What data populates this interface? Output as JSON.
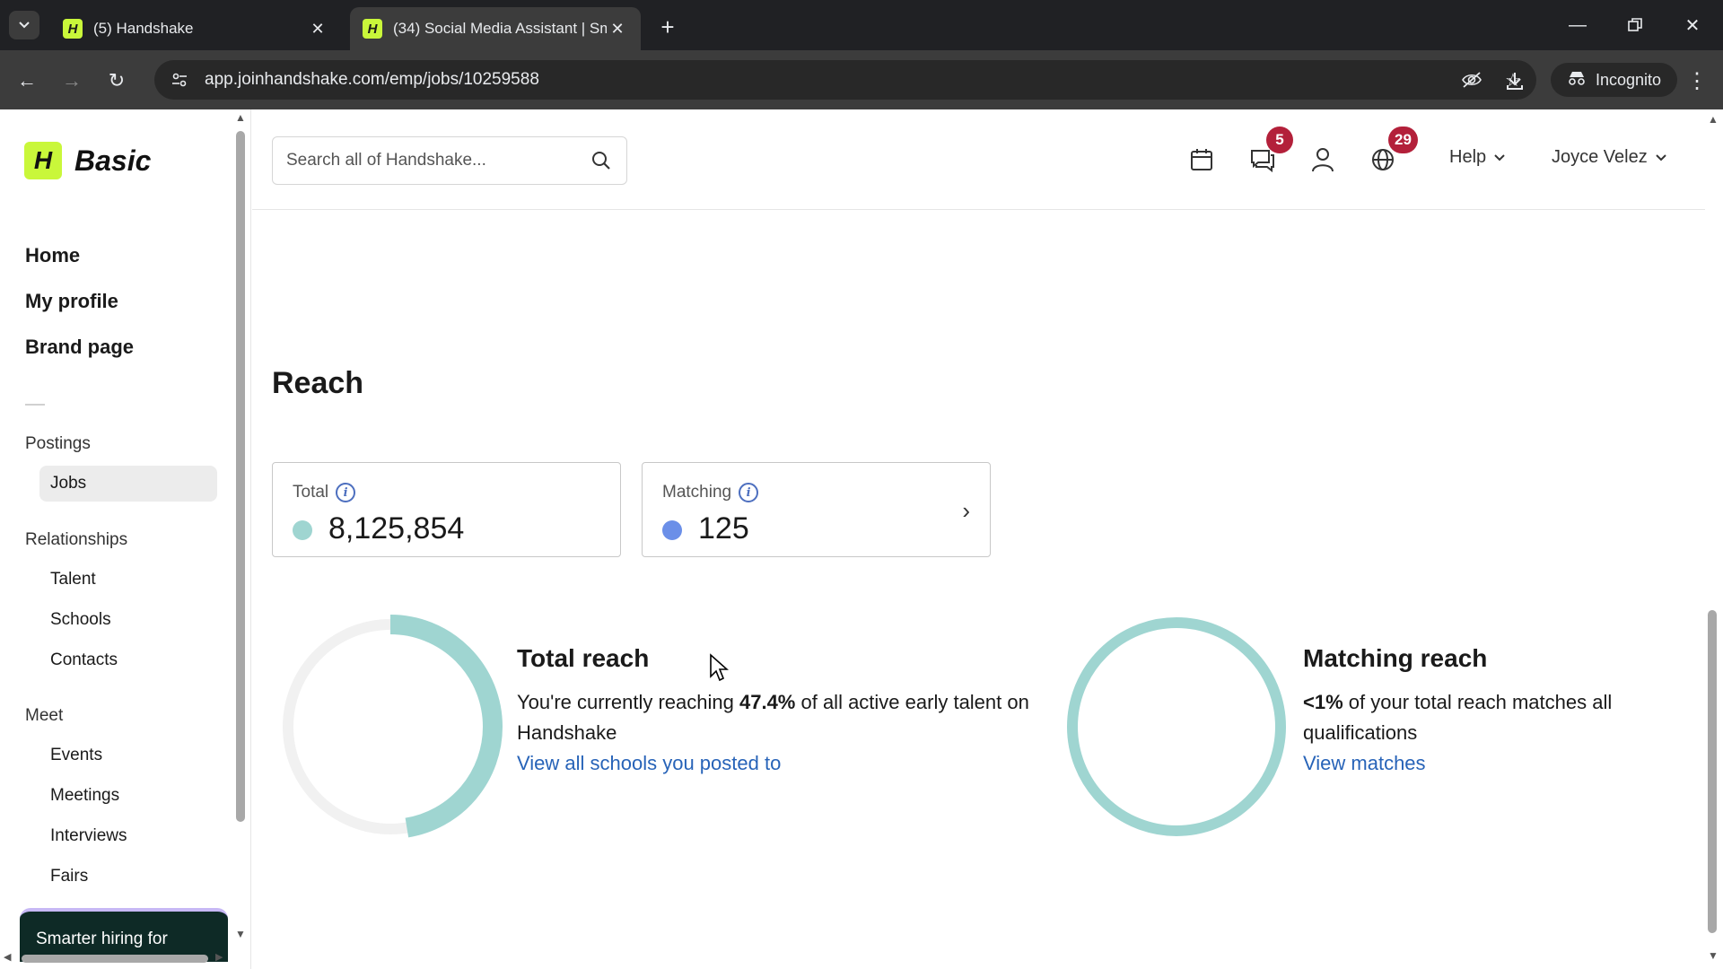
{
  "browser": {
    "tabs": [
      {
        "title": "(5) Handshake",
        "favicon": "H"
      },
      {
        "title": "(34) Social Media Assistant | Sm",
        "favicon": "H"
      }
    ],
    "url": "app.joinhandshake.com/emp/jobs/10259588",
    "incognito_label": "Incognito"
  },
  "sidebar": {
    "logo_letter": "H",
    "logo_text": "Basic",
    "primary": [
      {
        "label": "Home"
      },
      {
        "label": "My profile"
      },
      {
        "label": "Brand page"
      }
    ],
    "sections": {
      "postings": {
        "label": "Postings",
        "items": [
          {
            "label": "Jobs",
            "active": true
          }
        ]
      },
      "relationships": {
        "label": "Relationships",
        "items": [
          {
            "label": "Talent"
          },
          {
            "label": "Schools"
          },
          {
            "label": "Contacts"
          }
        ]
      },
      "meet": {
        "label": "Meet",
        "items": [
          {
            "label": "Events"
          },
          {
            "label": "Meetings"
          },
          {
            "label": "Interviews"
          },
          {
            "label": "Fairs"
          }
        ]
      }
    },
    "promo_text": "Smarter hiring for"
  },
  "header": {
    "search_placeholder": "Search all of Handshake...",
    "messages_badge": "5",
    "globe_badge": "29",
    "help_label": "Help",
    "user_name": "Joyce Velez"
  },
  "reach": {
    "title": "Reach",
    "total": {
      "label": "Total",
      "value": "8,125,854",
      "dot_color": "#9fd5d1"
    },
    "matching": {
      "label": "Matching",
      "value": "125",
      "dot_color": "#6b8fe8"
    },
    "total_reach": {
      "heading": "Total reach",
      "text_prefix": "You're currently reaching ",
      "percent": "47.4%",
      "percent_value": 47.4,
      "text_suffix": " of all active early talent on Handshake",
      "link": "View all schools you posted to"
    },
    "matching_reach": {
      "heading": "Matching reach",
      "percent": "<1%",
      "text_suffix": " of your total reach matches all qualifications",
      "link": "View matches"
    },
    "ring_color": "#9fd5d1",
    "ring_track_color": "#f1f1f1"
  }
}
